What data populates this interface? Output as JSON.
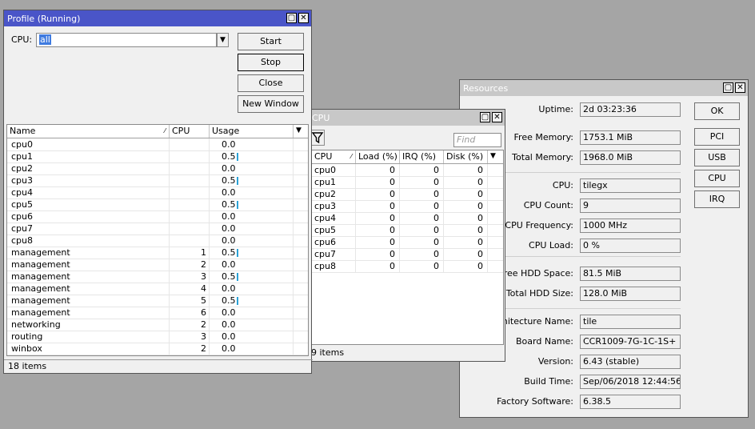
{
  "profile": {
    "title": "Profile (Running)",
    "cpu_label": "CPU:",
    "cpu_value": "all",
    "buttons": {
      "start": "Start",
      "stop": "Stop",
      "close": "Close",
      "new_window": "New Window"
    },
    "columns": [
      "Name",
      "CPU",
      "Usage"
    ],
    "rows": [
      {
        "name": "cpu0",
        "cpu": "",
        "usage": "0.0",
        "bar": false
      },
      {
        "name": "cpu1",
        "cpu": "",
        "usage": "0.5",
        "bar": true
      },
      {
        "name": "cpu2",
        "cpu": "",
        "usage": "0.0",
        "bar": false
      },
      {
        "name": "cpu3",
        "cpu": "",
        "usage": "0.5",
        "bar": true
      },
      {
        "name": "cpu4",
        "cpu": "",
        "usage": "0.0",
        "bar": false
      },
      {
        "name": "cpu5",
        "cpu": "",
        "usage": "0.5",
        "bar": true
      },
      {
        "name": "cpu6",
        "cpu": "",
        "usage": "0.0",
        "bar": false
      },
      {
        "name": "cpu7",
        "cpu": "",
        "usage": "0.0",
        "bar": false
      },
      {
        "name": "cpu8",
        "cpu": "",
        "usage": "0.0",
        "bar": false
      },
      {
        "name": "management",
        "cpu": "1",
        "usage": "0.5",
        "bar": true
      },
      {
        "name": "management",
        "cpu": "2",
        "usage": "0.0",
        "bar": false
      },
      {
        "name": "management",
        "cpu": "3",
        "usage": "0.5",
        "bar": true
      },
      {
        "name": "management",
        "cpu": "4",
        "usage": "0.0",
        "bar": false
      },
      {
        "name": "management",
        "cpu": "5",
        "usage": "0.5",
        "bar": true
      },
      {
        "name": "management",
        "cpu": "6",
        "usage": "0.0",
        "bar": false
      },
      {
        "name": "networking",
        "cpu": "2",
        "usage": "0.0",
        "bar": false
      },
      {
        "name": "routing",
        "cpu": "3",
        "usage": "0.0",
        "bar": false
      },
      {
        "name": "winbox",
        "cpu": "2",
        "usage": "0.0",
        "bar": false
      }
    ],
    "status": "18 items"
  },
  "cpu_window": {
    "title": "CPU",
    "find_placeholder": "Find",
    "columns": [
      "CPU",
      "Load (%)",
      "IRQ (%)",
      "Disk (%)"
    ],
    "rows": [
      [
        "cpu0",
        "0",
        "0",
        "0"
      ],
      [
        "cpu1",
        "0",
        "0",
        "0"
      ],
      [
        "cpu2",
        "0",
        "0",
        "0"
      ],
      [
        "cpu3",
        "0",
        "0",
        "0"
      ],
      [
        "cpu4",
        "0",
        "0",
        "0"
      ],
      [
        "cpu5",
        "0",
        "0",
        "0"
      ],
      [
        "cpu6",
        "0",
        "0",
        "0"
      ],
      [
        "cpu7",
        "0",
        "0",
        "0"
      ],
      [
        "cpu8",
        "0",
        "0",
        "0"
      ]
    ],
    "status": "9 items"
  },
  "resources": {
    "title": "Resources",
    "buttons": {
      "ok": "OK",
      "pci": "PCI",
      "usb": "USB",
      "cpu": "CPU",
      "irq": "IRQ"
    },
    "fields": [
      {
        "label": "Uptime:",
        "value": "2d 03:23:36"
      },
      {
        "label": "Free Memory:",
        "value": "1753.1 MiB"
      },
      {
        "label": "Total Memory:",
        "value": "1968.0 MiB"
      },
      {
        "label": "CPU:",
        "value": "tilegx"
      },
      {
        "label": "CPU Count:",
        "value": "9"
      },
      {
        "label": "CPU Frequency:",
        "value": "1000 MHz"
      },
      {
        "label": "CPU Load:",
        "value": "0 %"
      },
      {
        "label": "Free HDD Space:",
        "value": "81.5 MiB"
      },
      {
        "label": "Total HDD Size:",
        "value": "128.0 MiB"
      },
      {
        "label": "Architecture Name:",
        "value": "tile"
      },
      {
        "label": "Board Name:",
        "value": "CCR1009-7G-1C-1S+"
      },
      {
        "label": "Version:",
        "value": "6.43 (stable)"
      },
      {
        "label": "Build Time:",
        "value": "Sep/06/2018 12:44:56"
      },
      {
        "label": "Factory Software:",
        "value": "6.38.5"
      }
    ]
  }
}
